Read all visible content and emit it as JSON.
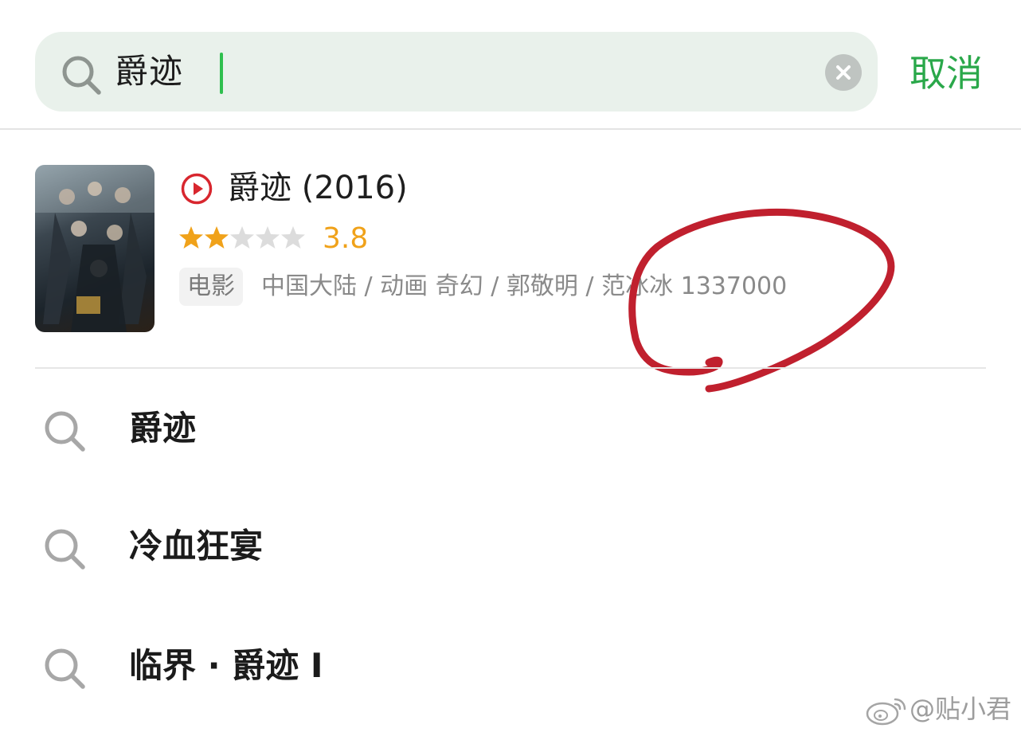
{
  "search": {
    "query": "爵迹",
    "cancel_label": "取消"
  },
  "result": {
    "title": "爵迹 (2016)",
    "rating": "3.8",
    "rating_stars": 2,
    "rating_stars_max": 5,
    "category": "电影",
    "meta": "中国大陆 / 动画 奇幻 / 郭敬明 / 范冰冰 1337000",
    "play_icon": "play-circle-icon"
  },
  "suggestions": [
    {
      "label": "爵迹",
      "icon": "search-icon"
    },
    {
      "label": "冷血狂宴",
      "icon": "search-icon"
    },
    {
      "label": "临界 · 爵迹 I",
      "icon": "search-icon"
    }
  ],
  "watermark": {
    "text": "@贴小君",
    "icon": "weibo-logo-icon"
  },
  "colors": {
    "accent_green": "#2aa84a",
    "caret_green": "#2fbf4e",
    "search_bg": "#e9f1eb",
    "rating_orange": "#f0a21a",
    "play_red": "#d8262e",
    "annotation_red": "#c0202e"
  }
}
